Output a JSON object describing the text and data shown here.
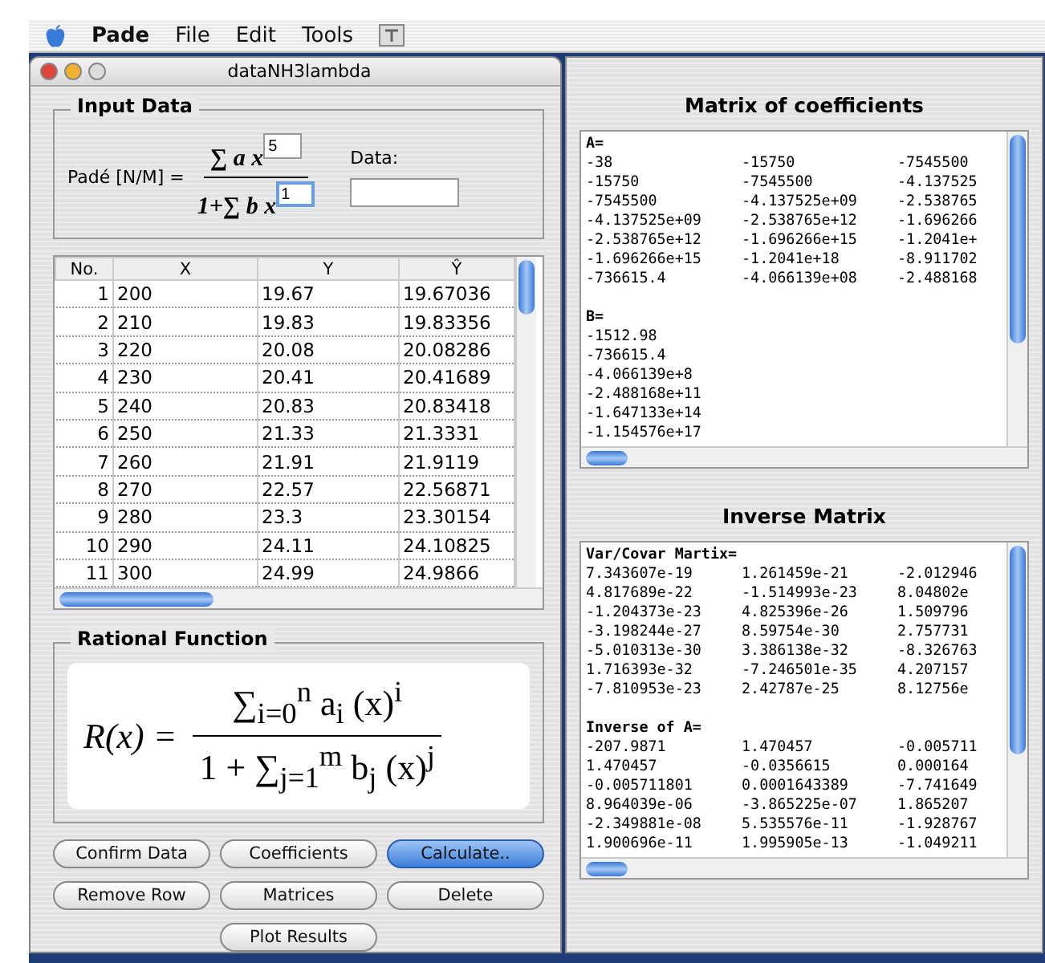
{
  "menu_bar": {
    "app_name": "Pade",
    "items": [
      "File",
      "Edit",
      "Tools"
    ]
  },
  "window": {
    "title": "dataNH3lambda"
  },
  "input_data": {
    "title": "Input Data",
    "label": "Padé [N/M] =",
    "numerator": "∑ a x",
    "denominator": "1+∑ b x",
    "numerator_exponent": {
      "value": "5",
      "focused": false
    },
    "denominator_exponent": {
      "value": "1",
      "focused": true
    },
    "data_label": "Data:"
  },
  "table": {
    "columns": [
      "No.",
      "X",
      "Y",
      "Ŷ"
    ],
    "rows": [
      [
        "1",
        "200",
        "19.67",
        "19.67036"
      ],
      [
        "2",
        "210",
        "19.83",
        "19.83356"
      ],
      [
        "3",
        "220",
        "20.08",
        "20.08286"
      ],
      [
        "4",
        "230",
        "20.41",
        "20.41689"
      ],
      [
        "5",
        "240",
        "20.83",
        "20.83418"
      ],
      [
        "6",
        "250",
        "21.33",
        "21.3331"
      ],
      [
        "7",
        "260",
        "21.91",
        "21.9119"
      ],
      [
        "8",
        "270",
        "22.57",
        "22.56871"
      ],
      [
        "9",
        "280",
        "23.3",
        "23.30154"
      ],
      [
        "10",
        "290",
        "24.11",
        "24.10825"
      ],
      [
        "11",
        "300",
        "24.99",
        "24.9866"
      ]
    ]
  },
  "rational_function": {
    "title": "Rational Function",
    "lhs": "R(x) =",
    "numerator": "∑$_{i=0}$$^{n}$ a$_{i}$ (x)$^{i}$",
    "denominator": "1 + ∑$_{j=1}$$^{m}$ b$_{j}$ (x)$^{j}$"
  },
  "buttons": [
    {
      "label": "Confirm Data",
      "default": false
    },
    {
      "label": "Coefficients",
      "default": false
    },
    {
      "label": "Calculate..",
      "default": true
    },
    {
      "label": "Remove Row",
      "default": false
    },
    {
      "label": "Matrices",
      "default": false
    },
    {
      "label": "Delete",
      "default": false
    },
    {
      "label": "Plot Results",
      "default": false
    }
  ],
  "panels": [
    {
      "title": "Matrix of coefficients",
      "sections": [
        {
          "heading": "A=",
          "rows": [
            [
              "-38",
              "-15750",
              "-7545500"
            ],
            [
              "-15750",
              "-7545500",
              "-4.137525"
            ],
            [
              "-7545500",
              "-4.137525e+09",
              "-2.538765"
            ],
            [
              "-4.137525e+09",
              "-2.538765e+12",
              "-1.696266"
            ],
            [
              "-2.538765e+12",
              "-1.696266e+15",
              "-1.2041e+"
            ],
            [
              "-1.696266e+15",
              "-1.2041e+18",
              "-8.911702"
            ],
            [
              "-736615.4",
              "-4.066139e+08",
              "-2.488168"
            ]
          ]
        },
        {
          "heading": "B=",
          "rows": [
            [
              "-1512.98"
            ],
            [
              "-736615.4"
            ],
            [
              "-4.066139e+8"
            ],
            [
              "-2.488168e+11"
            ],
            [
              "-1.647133e+14"
            ],
            [
              "-1.154576e+17"
            ]
          ]
        }
      ]
    },
    {
      "title": "Inverse Matrix",
      "sections": [
        {
          "heading": "Var/Covar Martix=",
          "rows": [
            [
              "7.343607e-19",
              "1.261459e-21",
              "-2.012946"
            ],
            [
              "4.817689e-22",
              "-1.514993e-23",
              "8.04802e"
            ],
            [
              "-1.204373e-23",
              "4.825396e-26",
              "1.509796"
            ],
            [
              "-3.198244e-27",
              "8.59754e-30",
              "2.757731"
            ],
            [
              "-5.010313e-30",
              "3.386138e-32",
              "-8.326763"
            ],
            [
              "1.716393e-32",
              "-7.246501e-35",
              "4.207157"
            ],
            [
              "-7.810953e-23",
              "2.42787e-25",
              "8.12756e"
            ]
          ]
        },
        {
          "heading": "Inverse of A=",
          "rows": [
            [
              "-207.9871",
              "1.470457",
              "-0.005711"
            ],
            [
              "1.470457",
              "-0.0356615",
              "0.000164"
            ],
            [
              "-0.005711801",
              "0.0001643389",
              "-7.741649"
            ],
            [
              "8.964039e-06",
              "-3.865225e-07",
              "1.865207"
            ],
            [
              "-2.349881e-08",
              "5.535576e-11",
              "-1.928767"
            ],
            [
              "1.900696e-11",
              "1.995905e-13",
              "-1.049211"
            ]
          ]
        }
      ]
    }
  ]
}
